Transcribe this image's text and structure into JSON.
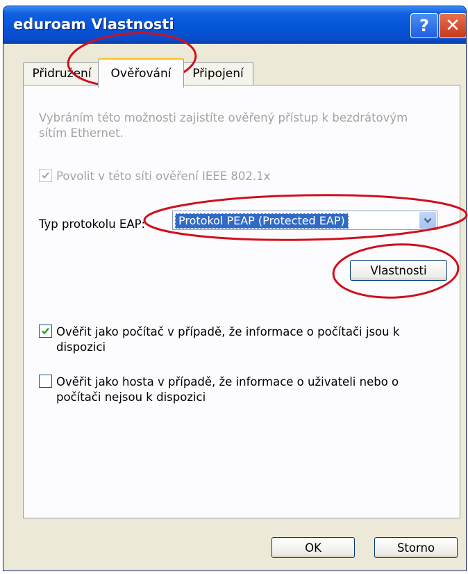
{
  "window": {
    "title": "eduroam Vlastnosti",
    "help_label": "?"
  },
  "tabs": [
    {
      "label": "Přidružení",
      "active": false
    },
    {
      "label": "Ověřování",
      "active": true
    },
    {
      "label": "Připojení",
      "active": false
    }
  ],
  "auth": {
    "description": "Vybráním této možnosti zajistíte ověřený přístup k bezdrátovým sítím Ethernet.",
    "enable_8021x": {
      "label": "Povolit v této síti ověření IEEE 802.1x",
      "checked": true,
      "enabled": false
    },
    "eap_type_label": "Typ protokolu EAP:",
    "eap_type_value": "Protokol PEAP (Protected EAP)",
    "properties_button": "Vlastnosti",
    "auth_as_computer": {
      "label": "Ověřit jako počítač v případě, že informace o počítači jsou k dispozici",
      "checked": true
    },
    "auth_as_guest": {
      "label": "Ověřit jako hosta v případě, že informace o uživateli nebo o počítači nejsou k dispozici",
      "checked": false
    }
  },
  "footer": {
    "ok_label": "OK",
    "cancel_label": "Storno"
  },
  "colors": {
    "titlebar": "#0555d9",
    "selection": "#316ac5",
    "annotation": "#d0101e",
    "tab_highlight": "#ffc83c"
  }
}
